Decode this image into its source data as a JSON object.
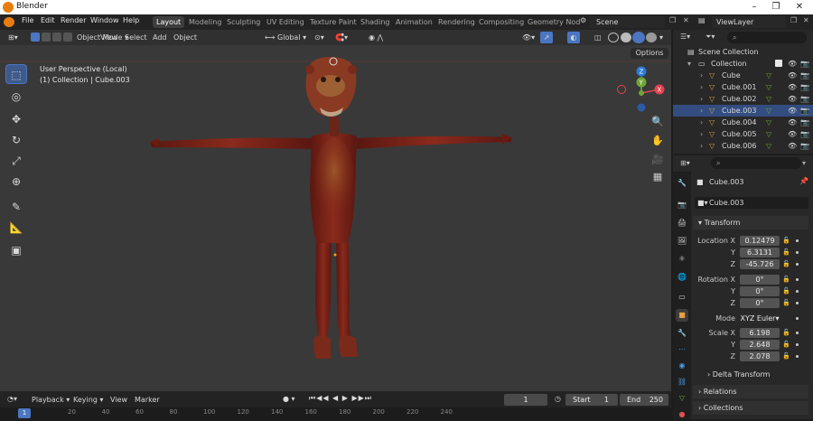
{
  "app": {
    "title": "Blender"
  },
  "window_controls": {
    "minimize": "–",
    "maximize": "❐",
    "close": "✕"
  },
  "menu": [
    "File",
    "Edit",
    "Render",
    "Window",
    "Help"
  ],
  "workspaces": [
    "Layout",
    "Modeling",
    "Sculpting",
    "UV Editing",
    "Texture Paint",
    "Shading",
    "Animation",
    "Rendering",
    "Compositing",
    "Geometry Nod"
  ],
  "scene": {
    "label": "Scene"
  },
  "viewlayer": {
    "label": "ViewLayer"
  },
  "viewport": {
    "mode": "Object Mode",
    "view": "View",
    "select": "Select",
    "add": "Add",
    "object": "Object",
    "orientation": "Global",
    "options": "Options",
    "info_line1": "User Perspective (Local)",
    "info_line2": "(1) Collection | Cube.003",
    "gizmo": {
      "x": "X",
      "y": "Y",
      "z": "Z"
    }
  },
  "outliner": {
    "scene_collection": "Scene Collection",
    "collection": "Collection",
    "items": [
      "Cube",
      "Cube.001",
      "Cube.002",
      "Cube.003",
      "Cube.004",
      "Cube.005",
      "Cube.006"
    ],
    "selected": "Cube.003"
  },
  "properties": {
    "object_name": "Cube.003",
    "mesh_name": "Cube.003",
    "transform_label": "Transform",
    "location": {
      "label": "Location X",
      "x": "0.12479",
      "y": "6.3131",
      "z": "-45.726"
    },
    "rotation": {
      "label": "Rotation X",
      "x": "0°",
      "y": "0°",
      "z": "0°"
    },
    "mode": {
      "label": "Mode",
      "value": "XYZ Euler"
    },
    "scale": {
      "label": "Scale X",
      "x": "6.198",
      "y": "2.648",
      "z": "2.078"
    },
    "axis_y": "Y",
    "axis_z": "Z",
    "delta": "Delta Transform",
    "relations": "Relations",
    "collections": "Collections"
  },
  "timeline": {
    "playback": "Playback",
    "keying": "Keying",
    "view": "View",
    "marker": "Marker",
    "current_frame": "1",
    "start_label": "Start",
    "start": "1",
    "end_label": "End",
    "end": "250",
    "ruler": [
      "1",
      "20",
      "40",
      "60",
      "80",
      "100",
      "120",
      "140",
      "160",
      "180",
      "200",
      "220",
      "240"
    ]
  },
  "colors": {
    "accent": "#4b76c2",
    "header": "#303030",
    "viewport": "#393939",
    "x_axis": "#e6414f",
    "y_axis": "#6fa834",
    "z_axis": "#2d7ad6"
  }
}
